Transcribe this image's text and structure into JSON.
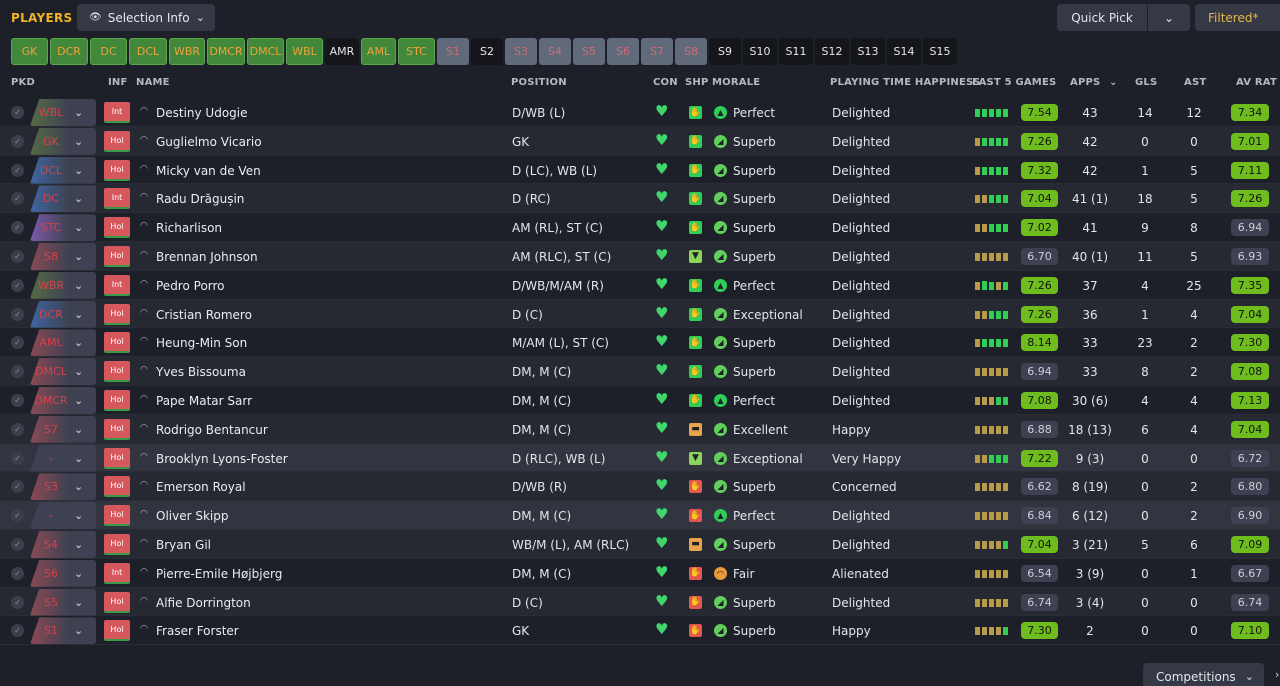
{
  "header": {
    "title": "PLAYERS",
    "selection_info": "Selection Info",
    "quick_pick": "Quick Pick",
    "filtered": "Filtered*"
  },
  "positions": [
    {
      "label": "GK",
      "state": "filled"
    },
    {
      "label": "DCR",
      "state": "filled"
    },
    {
      "label": "DC",
      "state": "filled"
    },
    {
      "label": "DCL",
      "state": "filled"
    },
    {
      "label": "WBR",
      "state": "filled"
    },
    {
      "label": "DMCR",
      "state": "filled"
    },
    {
      "label": "DMCL",
      "state": "filled"
    },
    {
      "label": "WBL",
      "state": "filled"
    },
    {
      "label": "AMR",
      "state": "empty"
    },
    {
      "label": "AML",
      "state": "filled"
    },
    {
      "label": "STC",
      "state": "filled"
    },
    {
      "label": "S1",
      "state": "sub"
    },
    {
      "label": "S2",
      "state": "empty"
    },
    {
      "label": "S3",
      "state": "sub"
    },
    {
      "label": "S4",
      "state": "sub"
    },
    {
      "label": "S5",
      "state": "sub"
    },
    {
      "label": "S6",
      "state": "sub"
    },
    {
      "label": "S7",
      "state": "sub"
    },
    {
      "label": "S8",
      "state": "sub"
    },
    {
      "label": "S9",
      "state": "empty"
    },
    {
      "label": "S10",
      "state": "empty"
    },
    {
      "label": "S11",
      "state": "empty"
    },
    {
      "label": "S12",
      "state": "empty"
    },
    {
      "label": "S13",
      "state": "empty"
    },
    {
      "label": "S14",
      "state": "empty"
    },
    {
      "label": "S15",
      "state": "empty"
    }
  ],
  "columns": {
    "pkd": "PKD",
    "inf": "INF",
    "name": "NAME",
    "position": "POSITION",
    "con": "CON",
    "shp": "SHP",
    "morale": "MORALE",
    "pth": "PLAYING TIME HAPPINESS",
    "last5": "LAST 5 GAMES",
    "apps": "APPS",
    "gls": "GLS",
    "ast": "AST",
    "avrat": "AV RAT"
  },
  "players": [
    {
      "pkd": "WBL",
      "tint": "g",
      "inf": "Int",
      "name": "Destiny Udogie",
      "position": "D/WB (L)",
      "shp": "good",
      "morale_icon": "top",
      "morale": "Perfect",
      "pth": "Delighted",
      "form": "ggggg",
      "form_rating": "7.54",
      "form_good": true,
      "apps": "43",
      "gls": "14",
      "ast": "12",
      "avrat": "7.34",
      "avrat_good": true
    },
    {
      "pkd": "GK",
      "tint": "g",
      "inf": "Hol",
      "name": "Guglielmo Vicario",
      "position": "GK",
      "shp": "good",
      "morale_icon": "good",
      "morale": "Superb",
      "pth": "Delighted",
      "form": "ygggg",
      "form_rating": "7.26",
      "form_good": true,
      "apps": "42",
      "gls": "0",
      "ast": "0",
      "avrat": "7.01",
      "avrat_good": true
    },
    {
      "pkd": "DCL",
      "tint": "b",
      "inf": "Hol",
      "name": "Micky van de Ven",
      "position": "D (LC), WB (L)",
      "shp": "good",
      "morale_icon": "good",
      "morale": "Superb",
      "pth": "Delighted",
      "form": "ygggg",
      "form_rating": "7.32",
      "form_good": true,
      "apps": "42",
      "gls": "1",
      "ast": "5",
      "avrat": "7.11",
      "avrat_good": true
    },
    {
      "pkd": "DC",
      "tint": "b",
      "inf": "Int",
      "name": "Radu Drăgușin",
      "position": "D (RC)",
      "shp": "good",
      "morale_icon": "good",
      "morale": "Superb",
      "pth": "Delighted",
      "form": "yyggg",
      "form_rating": "7.04",
      "form_good": true,
      "apps": "41 (1)",
      "gls": "18",
      "ast": "5",
      "avrat": "7.26",
      "avrat_good": true
    },
    {
      "pkd": "STC",
      "tint": "p",
      "inf": "Hol",
      "name": "Richarlison",
      "position": "AM (RL), ST (C)",
      "shp": "good",
      "morale_icon": "good",
      "morale": "Superb",
      "pth": "Delighted",
      "form": "yyggg",
      "form_rating": "7.02",
      "form_good": true,
      "apps": "41",
      "gls": "9",
      "ast": "8",
      "avrat": "6.94",
      "avrat_good": false
    },
    {
      "pkd": "S8",
      "tint": "r",
      "inf": "Hol",
      "name": "Brennan Johnson",
      "position": "AM (RLC), ST (C)",
      "shp": "ok",
      "morale_icon": "good",
      "morale": "Superb",
      "pth": "Delighted",
      "form": "yyyyy",
      "form_rating": "6.70",
      "form_good": false,
      "apps": "40 (1)",
      "gls": "11",
      "ast": "5",
      "avrat": "6.93",
      "avrat_good": false
    },
    {
      "pkd": "WBR",
      "tint": "g",
      "inf": "Int",
      "name": "Pedro Porro",
      "position": "D/WB/M/AM (R)",
      "shp": "good",
      "morale_icon": "top",
      "morale": "Perfect",
      "pth": "Delighted",
      "form": "yGgyg",
      "form_rating": "7.26",
      "form_good": true,
      "apps": "37",
      "gls": "4",
      "ast": "25",
      "avrat": "7.35",
      "avrat_good": true
    },
    {
      "pkd": "DCR",
      "tint": "b",
      "inf": "Hol",
      "name": "Cristian Romero",
      "position": "D (C)",
      "shp": "good",
      "morale_icon": "good",
      "morale": "Exceptional",
      "pth": "Delighted",
      "form": "yyggg",
      "form_rating": "7.26",
      "form_good": true,
      "apps": "36",
      "gls": "1",
      "ast": "4",
      "avrat": "7.04",
      "avrat_good": true
    },
    {
      "pkd": "AML",
      "tint": "r",
      "inf": "Hol",
      "name": "Heung-Min Son",
      "position": "M/AM (L), ST (C)",
      "shp": "good",
      "morale_icon": "good",
      "morale": "Superb",
      "pth": "Delighted",
      "form": "ygggg",
      "form_rating": "8.14",
      "form_good": true,
      "apps": "33",
      "gls": "23",
      "ast": "2",
      "avrat": "7.30",
      "avrat_good": true
    },
    {
      "pkd": "DMCL",
      "tint": "r",
      "inf": "Hol",
      "name": "Yves Bissouma",
      "position": "DM, M (C)",
      "shp": "good",
      "morale_icon": "good",
      "morale": "Superb",
      "pth": "Delighted",
      "form": "yyyyy",
      "form_rating": "6.94",
      "form_good": false,
      "apps": "33",
      "gls": "8",
      "ast": "2",
      "avrat": "7.08",
      "avrat_good": true
    },
    {
      "pkd": "DMCR",
      "tint": "r",
      "inf": "Hol",
      "name": "Pape Matar Sarr",
      "position": "DM, M (C)",
      "shp": "good",
      "morale_icon": "top",
      "morale": "Perfect",
      "pth": "Delighted",
      "form": "yyygg",
      "form_rating": "7.08",
      "form_good": true,
      "apps": "30 (6)",
      "gls": "4",
      "ast": "4",
      "avrat": "7.13",
      "avrat_good": true
    },
    {
      "pkd": "S7",
      "tint": "r",
      "inf": "Hol",
      "name": "Rodrigo Bentancur",
      "position": "DM, M (C)",
      "shp": "warn",
      "morale_icon": "good",
      "morale": "Excellent",
      "pth": "Happy",
      "form": "yyyyy",
      "form_rating": "6.88",
      "form_good": false,
      "apps": "18 (13)",
      "gls": "6",
      "ast": "4",
      "avrat": "7.04",
      "avrat_good": true
    },
    {
      "pkd": "-",
      "tint": "",
      "inf": "Hol",
      "name": "Brooklyn Lyons-Foster",
      "position": "D (RLC), WB (L)",
      "shp": "ok",
      "morale_icon": "good",
      "morale": "Exceptional",
      "pth": "Very Happy",
      "form": "yyggg",
      "form_rating": "7.22",
      "form_good": true,
      "apps": "9 (3)",
      "gls": "0",
      "ast": "0",
      "avrat": "6.72",
      "avrat_good": false
    },
    {
      "pkd": "S3",
      "tint": "r",
      "inf": "Hol",
      "name": "Emerson Royal",
      "position": "D/WB (R)",
      "shp": "bad",
      "morale_icon": "good",
      "morale": "Superb",
      "pth": "Concerned",
      "form": "yyyyy",
      "form_rating": "6.62",
      "form_good": false,
      "apps": "8 (19)",
      "gls": "0",
      "ast": "2",
      "avrat": "6.80",
      "avrat_good": false
    },
    {
      "pkd": "-",
      "tint": "",
      "inf": "Hol",
      "name": "Oliver Skipp",
      "position": "DM, M (C)",
      "shp": "bad",
      "morale_icon": "top",
      "morale": "Perfect",
      "pth": "Delighted",
      "form": "yyyyy",
      "form_rating": "6.84",
      "form_good": false,
      "apps": "6 (12)",
      "gls": "0",
      "ast": "2",
      "avrat": "6.90",
      "avrat_good": false
    },
    {
      "pkd": "S4",
      "tint": "r",
      "inf": "Hol",
      "name": "Bryan Gil",
      "position": "WB/M (L), AM (RLC)",
      "shp": "warn",
      "morale_icon": "good",
      "morale": "Superb",
      "pth": "Delighted",
      "form": "yyyyg",
      "form_rating": "7.04",
      "form_good": true,
      "apps": "3 (21)",
      "gls": "5",
      "ast": "6",
      "avrat": "7.09",
      "avrat_good": true
    },
    {
      "pkd": "S6",
      "tint": "r",
      "inf": "Int",
      "name": "Pierre-Emile Højbjerg",
      "position": "DM, M (C)",
      "shp": "bad",
      "morale_icon": "fair",
      "morale": "Fair",
      "pth": "Alienated",
      "form": "yyyyy",
      "form_rating": "6.54",
      "form_good": false,
      "apps": "3 (9)",
      "gls": "0",
      "ast": "1",
      "avrat": "6.67",
      "avrat_good": false
    },
    {
      "pkd": "S5",
      "tint": "r",
      "inf": "Hol",
      "name": "Alfie Dorrington",
      "position": "D (C)",
      "shp": "bad",
      "morale_icon": "good",
      "morale": "Superb",
      "pth": "Delighted",
      "form": "yyyyy",
      "form_rating": "6.74",
      "form_good": false,
      "apps": "3 (4)",
      "gls": "0",
      "ast": "0",
      "avrat": "6.74",
      "avrat_good": false
    },
    {
      "pkd": "S1",
      "tint": "r",
      "inf": "Hol",
      "name": "Fraser Forster",
      "position": "GK",
      "shp": "bad",
      "morale_icon": "good",
      "morale": "Superb",
      "pth": "Happy",
      "form": "yyyyg",
      "form_rating": "7.30",
      "form_good": true,
      "apps": "2",
      "gls": "0",
      "ast": "0",
      "avrat": "7.10",
      "avrat_good": true
    }
  ],
  "footer": {
    "competitions": "Competitions"
  }
}
